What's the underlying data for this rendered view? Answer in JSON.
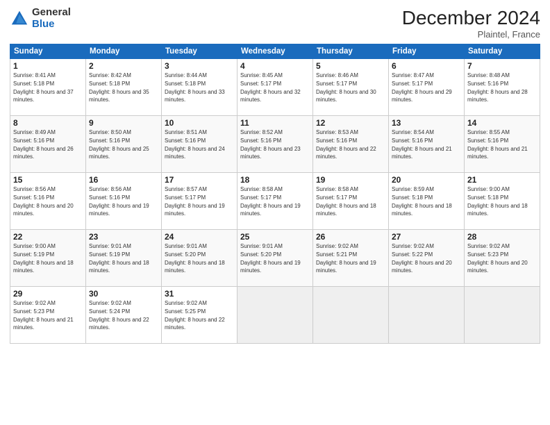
{
  "logo": {
    "general": "General",
    "blue": "Blue"
  },
  "title": "December 2024",
  "location": "Plaintel, France",
  "days_of_week": [
    "Sunday",
    "Monday",
    "Tuesday",
    "Wednesday",
    "Thursday",
    "Friday",
    "Saturday"
  ],
  "weeks": [
    [
      {
        "day": "1",
        "sunrise": "Sunrise: 8:41 AM",
        "sunset": "Sunset: 5:18 PM",
        "daylight": "Daylight: 8 hours and 37 minutes."
      },
      {
        "day": "2",
        "sunrise": "Sunrise: 8:42 AM",
        "sunset": "Sunset: 5:18 PM",
        "daylight": "Daylight: 8 hours and 35 minutes."
      },
      {
        "day": "3",
        "sunrise": "Sunrise: 8:44 AM",
        "sunset": "Sunset: 5:18 PM",
        "daylight": "Daylight: 8 hours and 33 minutes."
      },
      {
        "day": "4",
        "sunrise": "Sunrise: 8:45 AM",
        "sunset": "Sunset: 5:17 PM",
        "daylight": "Daylight: 8 hours and 32 minutes."
      },
      {
        "day": "5",
        "sunrise": "Sunrise: 8:46 AM",
        "sunset": "Sunset: 5:17 PM",
        "daylight": "Daylight: 8 hours and 30 minutes."
      },
      {
        "day": "6",
        "sunrise": "Sunrise: 8:47 AM",
        "sunset": "Sunset: 5:17 PM",
        "daylight": "Daylight: 8 hours and 29 minutes."
      },
      {
        "day": "7",
        "sunrise": "Sunrise: 8:48 AM",
        "sunset": "Sunset: 5:16 PM",
        "daylight": "Daylight: 8 hours and 28 minutes."
      }
    ],
    [
      {
        "day": "8",
        "sunrise": "Sunrise: 8:49 AM",
        "sunset": "Sunset: 5:16 PM",
        "daylight": "Daylight: 8 hours and 26 minutes."
      },
      {
        "day": "9",
        "sunrise": "Sunrise: 8:50 AM",
        "sunset": "Sunset: 5:16 PM",
        "daylight": "Daylight: 8 hours and 25 minutes."
      },
      {
        "day": "10",
        "sunrise": "Sunrise: 8:51 AM",
        "sunset": "Sunset: 5:16 PM",
        "daylight": "Daylight: 8 hours and 24 minutes."
      },
      {
        "day": "11",
        "sunrise": "Sunrise: 8:52 AM",
        "sunset": "Sunset: 5:16 PM",
        "daylight": "Daylight: 8 hours and 23 minutes."
      },
      {
        "day": "12",
        "sunrise": "Sunrise: 8:53 AM",
        "sunset": "Sunset: 5:16 PM",
        "daylight": "Daylight: 8 hours and 22 minutes."
      },
      {
        "day": "13",
        "sunrise": "Sunrise: 8:54 AM",
        "sunset": "Sunset: 5:16 PM",
        "daylight": "Daylight: 8 hours and 21 minutes."
      },
      {
        "day": "14",
        "sunrise": "Sunrise: 8:55 AM",
        "sunset": "Sunset: 5:16 PM",
        "daylight": "Daylight: 8 hours and 21 minutes."
      }
    ],
    [
      {
        "day": "15",
        "sunrise": "Sunrise: 8:56 AM",
        "sunset": "Sunset: 5:16 PM",
        "daylight": "Daylight: 8 hours and 20 minutes."
      },
      {
        "day": "16",
        "sunrise": "Sunrise: 8:56 AM",
        "sunset": "Sunset: 5:16 PM",
        "daylight": "Daylight: 8 hours and 19 minutes."
      },
      {
        "day": "17",
        "sunrise": "Sunrise: 8:57 AM",
        "sunset": "Sunset: 5:17 PM",
        "daylight": "Daylight: 8 hours and 19 minutes."
      },
      {
        "day": "18",
        "sunrise": "Sunrise: 8:58 AM",
        "sunset": "Sunset: 5:17 PM",
        "daylight": "Daylight: 8 hours and 19 minutes."
      },
      {
        "day": "19",
        "sunrise": "Sunrise: 8:58 AM",
        "sunset": "Sunset: 5:17 PM",
        "daylight": "Daylight: 8 hours and 18 minutes."
      },
      {
        "day": "20",
        "sunrise": "Sunrise: 8:59 AM",
        "sunset": "Sunset: 5:18 PM",
        "daylight": "Daylight: 8 hours and 18 minutes."
      },
      {
        "day": "21",
        "sunrise": "Sunrise: 9:00 AM",
        "sunset": "Sunset: 5:18 PM",
        "daylight": "Daylight: 8 hours and 18 minutes."
      }
    ],
    [
      {
        "day": "22",
        "sunrise": "Sunrise: 9:00 AM",
        "sunset": "Sunset: 5:19 PM",
        "daylight": "Daylight: 8 hours and 18 minutes."
      },
      {
        "day": "23",
        "sunrise": "Sunrise: 9:01 AM",
        "sunset": "Sunset: 5:19 PM",
        "daylight": "Daylight: 8 hours and 18 minutes."
      },
      {
        "day": "24",
        "sunrise": "Sunrise: 9:01 AM",
        "sunset": "Sunset: 5:20 PM",
        "daylight": "Daylight: 8 hours and 18 minutes."
      },
      {
        "day": "25",
        "sunrise": "Sunrise: 9:01 AM",
        "sunset": "Sunset: 5:20 PM",
        "daylight": "Daylight: 8 hours and 19 minutes."
      },
      {
        "day": "26",
        "sunrise": "Sunrise: 9:02 AM",
        "sunset": "Sunset: 5:21 PM",
        "daylight": "Daylight: 8 hours and 19 minutes."
      },
      {
        "day": "27",
        "sunrise": "Sunrise: 9:02 AM",
        "sunset": "Sunset: 5:22 PM",
        "daylight": "Daylight: 8 hours and 20 minutes."
      },
      {
        "day": "28",
        "sunrise": "Sunrise: 9:02 AM",
        "sunset": "Sunset: 5:23 PM",
        "daylight": "Daylight: 8 hours and 20 minutes."
      }
    ],
    [
      {
        "day": "29",
        "sunrise": "Sunrise: 9:02 AM",
        "sunset": "Sunset: 5:23 PM",
        "daylight": "Daylight: 8 hours and 21 minutes."
      },
      {
        "day": "30",
        "sunrise": "Sunrise: 9:02 AM",
        "sunset": "Sunset: 5:24 PM",
        "daylight": "Daylight: 8 hours and 22 minutes."
      },
      {
        "day": "31",
        "sunrise": "Sunrise: 9:02 AM",
        "sunset": "Sunset: 5:25 PM",
        "daylight": "Daylight: 8 hours and 22 minutes."
      },
      null,
      null,
      null,
      null
    ]
  ]
}
